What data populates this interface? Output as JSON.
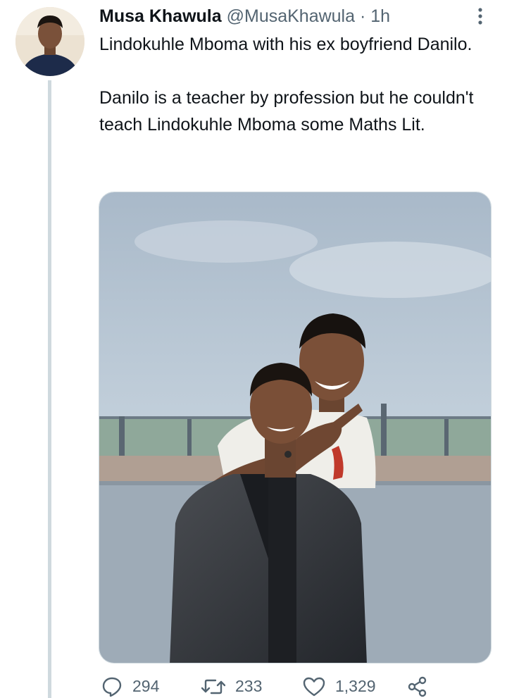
{
  "tweet": {
    "display_name": "Musa Khawula",
    "handle": "@MusaKhawula",
    "separator": "·",
    "time": "1h",
    "paragraphs": [
      "Lindokuhle Mboma with his ex boyfriend Danilo.",
      "Danilo is a teacher by profession but he couldn't teach Lindokuhle Mboma some Maths Lit."
    ],
    "avatar_icon": "profile-photo",
    "more_icon": "vertical-ellipsis-icon"
  },
  "actions": {
    "reply_count": "294",
    "retweet_count": "233",
    "like_count": "1,329",
    "icons": [
      "reply-icon",
      "retweet-icon",
      "like-icon",
      "share-icon"
    ]
  },
  "colors": {
    "text_primary": "#0f1419",
    "text_secondary": "#536471",
    "thread_line": "#cfd9de"
  }
}
